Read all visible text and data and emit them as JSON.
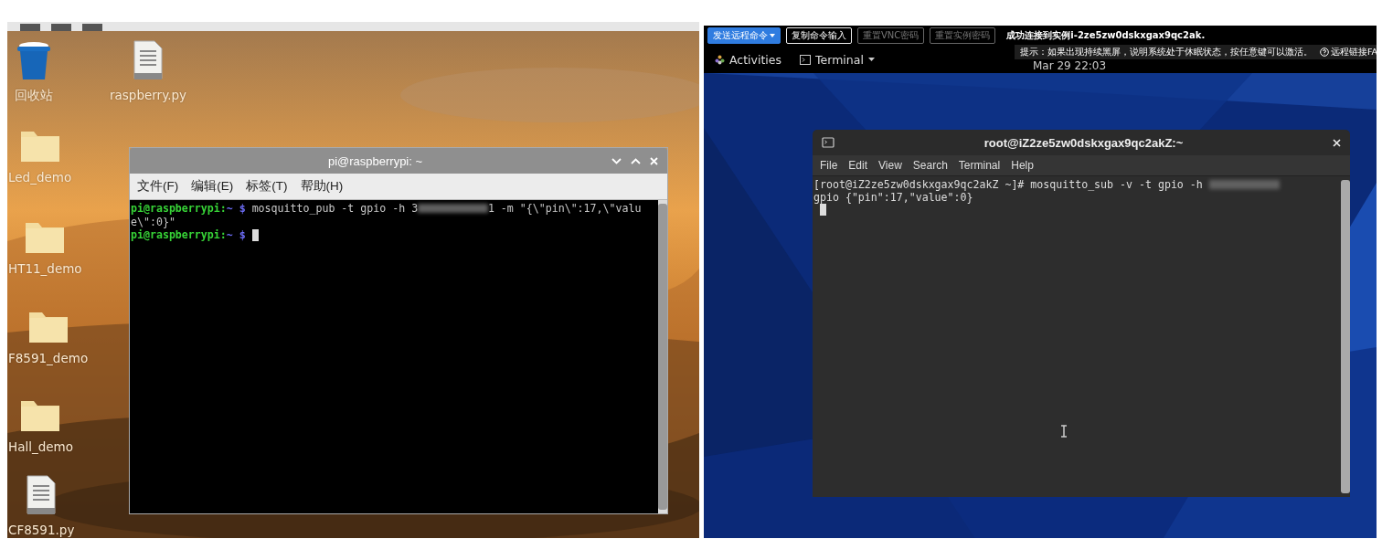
{
  "left_screen": {
    "desktop_icons": [
      {
        "label": "回收站",
        "kind": "trash"
      },
      {
        "label": "raspberry.py",
        "kind": "file"
      },
      {
        "label": "Led_demo",
        "kind": "folder"
      },
      {
        "label": "HT11_demo",
        "kind": "folder"
      },
      {
        "label": "F8591_demo",
        "kind": "folder"
      },
      {
        "label": "Hall_demo",
        "kind": "folder"
      },
      {
        "label": "CF8591.py",
        "kind": "file"
      }
    ],
    "terminal": {
      "title": "pi@raspberrypi: ~",
      "menu": [
        "文件(F)",
        "编辑(E)",
        "标签(T)",
        "帮助(H)"
      ],
      "lines": [
        [
          {
            "kind": "user",
            "text": "pi@raspberrypi:"
          },
          {
            "kind": "path",
            "text": "~ $"
          },
          {
            "kind": "text",
            "text": " mosquitto_pub -t gpio -h 3"
          },
          {
            "kind": "redacted"
          },
          {
            "kind": "text",
            "text": "1 -m \"{\\\"pin\\\":17,\\\"valu"
          }
        ],
        [
          {
            "kind": "text",
            "text": "e\\\":0}\""
          }
        ],
        [
          {
            "kind": "user",
            "text": "pi@raspberrypi:"
          },
          {
            "kind": "path",
            "text": "~ $"
          },
          {
            "kind": "cursor"
          }
        ]
      ]
    }
  },
  "right_screen": {
    "toolbar": {
      "buttons": [
        {
          "label": "发送远程命令",
          "kind": "dropdown",
          "disabled": false
        },
        {
          "label": "复制命令输入",
          "kind": "plain",
          "disabled": false
        },
        {
          "label": "重置VNC密码",
          "kind": "plain",
          "disabled": true
        },
        {
          "label": "重置实例密码",
          "kind": "plain",
          "disabled": true
        }
      ],
      "status": "成功连接到实例i-2ze5zw0dskxgax9qc2ak."
    },
    "tip": {
      "text": "提示：如果出现持续黑屏，说明系统处于休眠状态，按任意键可以激活。",
      "help_link": "远程链接FA"
    },
    "top_bar": {
      "activities": "Activities",
      "app_menu": "Terminal",
      "clock": "Mar 29  22:03"
    },
    "terminal": {
      "title": "root@iZ2ze5zw0dskxgax9qc2akZ:~",
      "menu": [
        "File",
        "Edit",
        "View",
        "Search",
        "Terminal",
        "Help"
      ],
      "lines": [
        [
          {
            "kind": "text",
            "text": "[root@iZ2ze5zw0dskxgax9qc2akZ ~]# mosquitto_sub -v -t gpio -h "
          },
          {
            "kind": "redacted"
          }
        ],
        [
          {
            "kind": "text",
            "text": "gpio {\"pin\":17,\"value\":0}"
          }
        ],
        [
          {
            "kind": "cursor"
          }
        ]
      ]
    }
  }
}
